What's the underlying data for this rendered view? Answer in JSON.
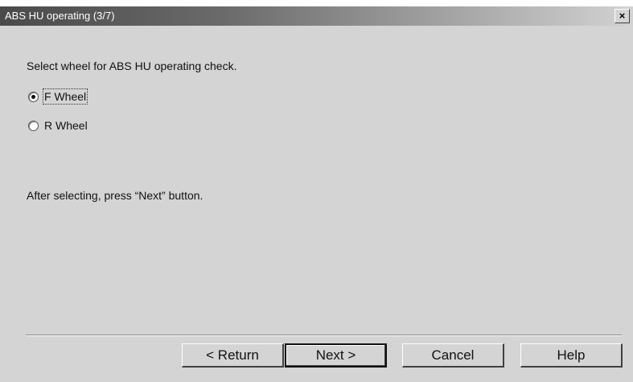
{
  "window": {
    "title": "ABS HU operating (3/7)",
    "close_label": "×"
  },
  "content": {
    "instruction": "Select wheel for ABS HU operating check.",
    "options": [
      {
        "label": "F Wheel",
        "selected": true
      },
      {
        "label": "R Wheel",
        "selected": false
      }
    ],
    "hint": "After selecting, press “Next” button."
  },
  "buttons": {
    "return_label": "< Return",
    "next_label": "Next >",
    "cancel_label": "Cancel",
    "help_label": "Help"
  }
}
